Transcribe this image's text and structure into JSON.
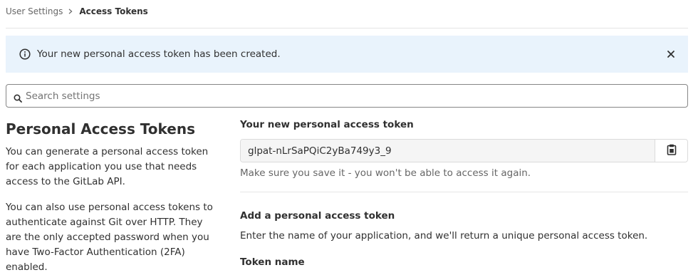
{
  "breadcrumb": {
    "parent": "User Settings",
    "current": "Access Tokens"
  },
  "alert": {
    "message": "Your new personal access token has been created.",
    "icon": "info-icon",
    "close_icon": "close-icon",
    "background": "#e9f3fc"
  },
  "search": {
    "placeholder": "Search settings",
    "value": "",
    "icon": "search-icon"
  },
  "left": {
    "title": "Personal Access Tokens",
    "paragraph1": "You can generate a personal access token for each application you use that needs access to the GitLab API.",
    "paragraph2": "You can also use personal access tokens to authenticate against Git over HTTP. They are the only accepted password when you have Two-Factor Authentication (2FA) enabled."
  },
  "new_token": {
    "label": "Your new personal access token",
    "value": "glpat-nLrSaPQiC2yBa749y3_9",
    "copy_icon": "clipboard-icon",
    "help": "Make sure you save it - you won't be able to access it again."
  },
  "add_token": {
    "title": "Add a personal access token",
    "description": "Enter the name of your application, and we'll return a unique personal access token.",
    "name_label": "Token name"
  }
}
